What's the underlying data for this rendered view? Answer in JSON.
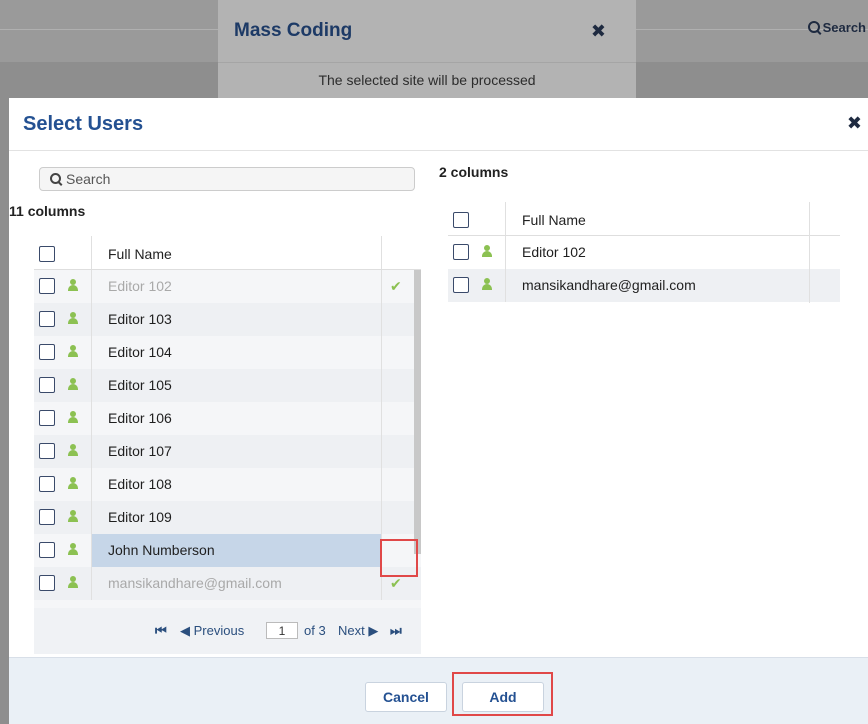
{
  "background": {
    "search_label": "Search"
  },
  "mass_coding": {
    "title": "Mass Coding",
    "close_icon": "close-icon",
    "message": "The selected site will be processed"
  },
  "select_users": {
    "title": "Select Users",
    "close_icon": "close-icon",
    "search": {
      "placeholder": "Search",
      "value": ""
    },
    "left_count": "11 columns",
    "right_count": "2 columns",
    "column_header": "Full Name",
    "left_rows": [
      {
        "name": "Editor 102",
        "added": true
      },
      {
        "name": "Editor 103",
        "added": false
      },
      {
        "name": "Editor 104",
        "added": false
      },
      {
        "name": "Editor 105",
        "added": false
      },
      {
        "name": "Editor 106",
        "added": false
      },
      {
        "name": "Editor 107",
        "added": false
      },
      {
        "name": "Editor 108",
        "added": false
      },
      {
        "name": "Editor 109",
        "added": false
      },
      {
        "name": "John Numberson",
        "added": false,
        "highlighted": true
      },
      {
        "name": "mansikandhare@gmail.com",
        "added": true
      }
    ],
    "right_rows": [
      {
        "name": "Editor 102"
      },
      {
        "name": "mansikandhare@gmail.com"
      }
    ],
    "pager": {
      "first_icon": "first-page-icon",
      "previous_label": "Previous",
      "page_value": "1",
      "of_label": "of 3",
      "next_label": "Next",
      "last_icon": "last-page-icon"
    },
    "footer": {
      "cancel_label": "Cancel",
      "add_label": "Add"
    }
  },
  "colors": {
    "title_blue": "#245192",
    "user_icon_green": "#8cc152",
    "highlight_row": "#c6d6e8",
    "callout_red": "#e04848"
  }
}
